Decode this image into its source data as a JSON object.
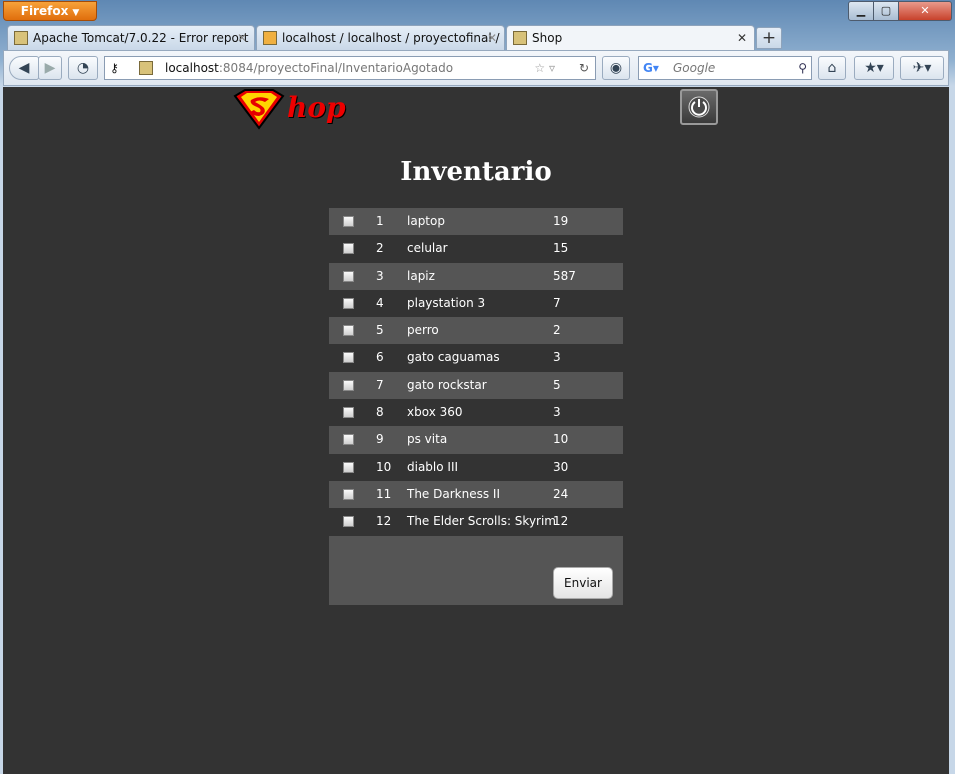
{
  "browser": {
    "menu_label": "Firefox",
    "tabs": [
      {
        "title": "Apache Tomcat/7.0.22 - Error report"
      },
      {
        "title": "localhost / localhost / proyectofinal / ..."
      },
      {
        "title": "Shop"
      }
    ],
    "url_host": "localhost",
    "url_path": ":8084/proyectoFinal/InventarioAgotado",
    "search_placeholder": "Google",
    "window_controls": {
      "minimize": "▁",
      "maximize": "▢",
      "close": "✕"
    }
  },
  "page": {
    "logo_text": "hop",
    "heading": "Inventario",
    "items": [
      {
        "id": "1",
        "name": "laptop",
        "qty": "19"
      },
      {
        "id": "2",
        "name": "celular",
        "qty": "15"
      },
      {
        "id": "3",
        "name": "lapiz",
        "qty": "587"
      },
      {
        "id": "4",
        "name": "playstation 3",
        "qty": "7"
      },
      {
        "id": "5",
        "name": "perro",
        "qty": "2"
      },
      {
        "id": "6",
        "name": "gato caguamas",
        "qty": "3"
      },
      {
        "id": "7",
        "name": "gato rockstar",
        "qty": "5"
      },
      {
        "id": "8",
        "name": "xbox 360",
        "qty": "3"
      },
      {
        "id": "9",
        "name": "ps vita",
        "qty": "10"
      },
      {
        "id": "10",
        "name": "diablo III",
        "qty": "30"
      },
      {
        "id": "11",
        "name": "The Darkness II",
        "qty": "24"
      },
      {
        "id": "12",
        "name": "The Elder Scrolls: Skyrim",
        "qty": "12"
      }
    ],
    "submit_label": "Enviar"
  },
  "colors": {
    "page_bg": "#333333",
    "row_alt": "#555555",
    "logo_red": "#e00000"
  }
}
